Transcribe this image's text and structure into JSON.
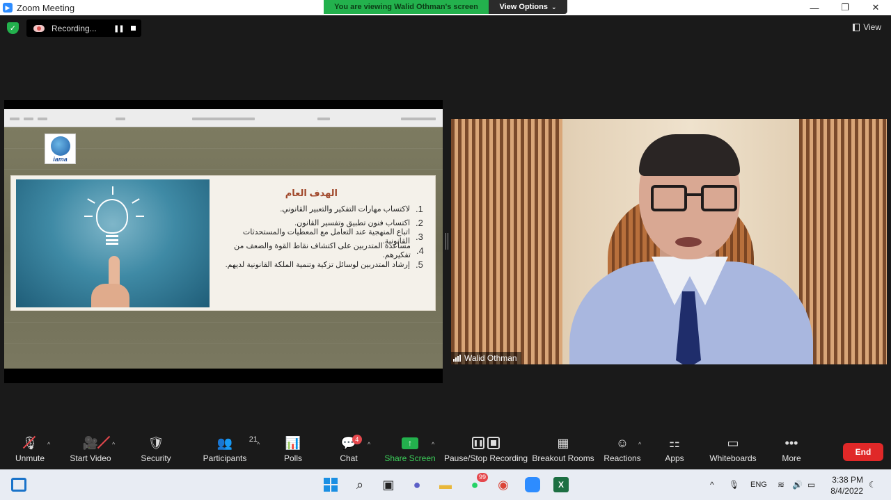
{
  "window": {
    "title": "Zoom Meeting",
    "minimize": "—",
    "restore": "❐",
    "close": "✕"
  },
  "banner": {
    "viewing": "You are viewing Walid Othman's screen",
    "view_options": "View Options"
  },
  "recording": {
    "label": "Recording..."
  },
  "view_button": "View",
  "slide": {
    "logo_text": "iama",
    "title": "الهدف العام",
    "items": [
      {
        "num": "1.",
        "text": "لاكتساب مهارات التفكير والتعبير القانوني."
      },
      {
        "num": "2.",
        "text": "اكتساب فنون تطبيق وتفسير القانون."
      },
      {
        "num": "3.",
        "text": "اتباع المنهجية عند التعامل مع المعطيات والمستحدثات القانونية."
      },
      {
        "num": "4.",
        "text": "مساعدة المتدربين على اكتشاف نقاط القوة والضعف من تفكيرهم."
      },
      {
        "num": "5.",
        "text": "إرشاد المتدربين لوسائل تزكية وتنمية الملكة القانونية لديهم."
      }
    ]
  },
  "participant": {
    "name": "Walid Othman"
  },
  "toolbar": {
    "unmute": "Unmute",
    "start_video": "Start Video",
    "security": "Security",
    "participants": "Participants",
    "participants_count": "21",
    "polls": "Polls",
    "chat": "Chat",
    "chat_badge": "4",
    "share_screen": "Share Screen",
    "pause_stop_recording": "Pause/Stop Recording",
    "breakout_rooms": "Breakout Rooms",
    "reactions": "Reactions",
    "apps": "Apps",
    "whiteboards": "Whiteboards",
    "more": "More",
    "end": "End"
  },
  "taskbar": {
    "whatsapp_badge": "99",
    "language": "ENG",
    "time": "3:38 PM",
    "date": "8/4/2022"
  },
  "colors": {
    "zoom_blue": "#2d8cff",
    "share_green": "#23b14d",
    "end_red": "#e02828",
    "slide_title": "#a0472a"
  }
}
